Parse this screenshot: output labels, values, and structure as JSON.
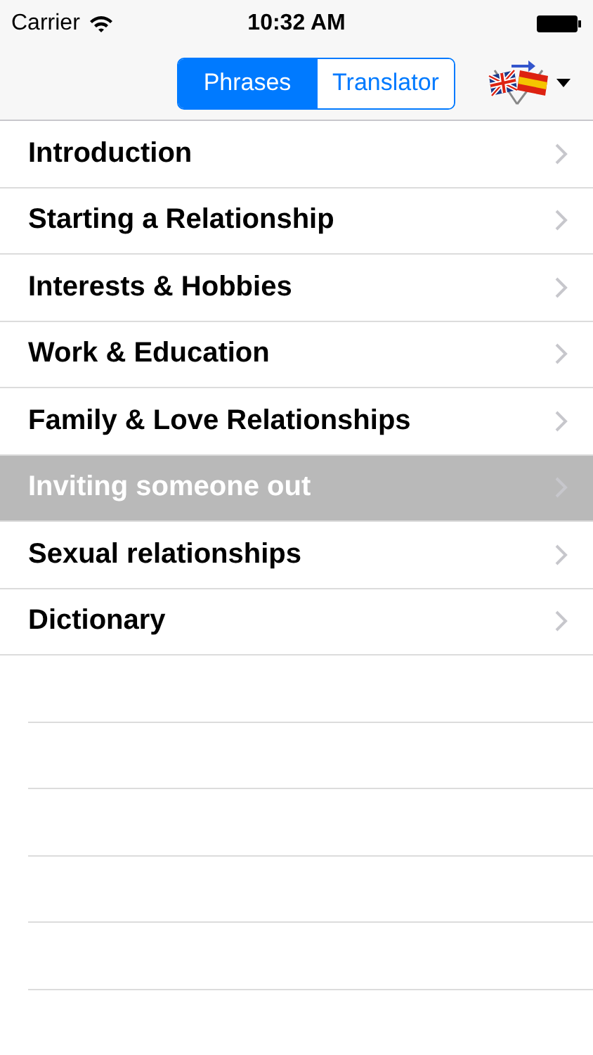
{
  "status_bar": {
    "carrier": "Carrier",
    "time": "10:32 AM"
  },
  "segments": [
    {
      "label": "Phrases",
      "selected": true
    },
    {
      "label": "Translator",
      "selected": false
    }
  ],
  "list": [
    {
      "label": "Introduction",
      "selected": false
    },
    {
      "label": "Starting a Relationship",
      "selected": false
    },
    {
      "label": "Interests & Hobbies",
      "selected": false
    },
    {
      "label": "Work & Education",
      "selected": false
    },
    {
      "label": "Family & Love Relationships",
      "selected": false
    },
    {
      "label": "Inviting someone out",
      "selected": true
    },
    {
      "label": "Sexual relationships",
      "selected": false
    },
    {
      "label": "Dictionary",
      "selected": false
    }
  ]
}
